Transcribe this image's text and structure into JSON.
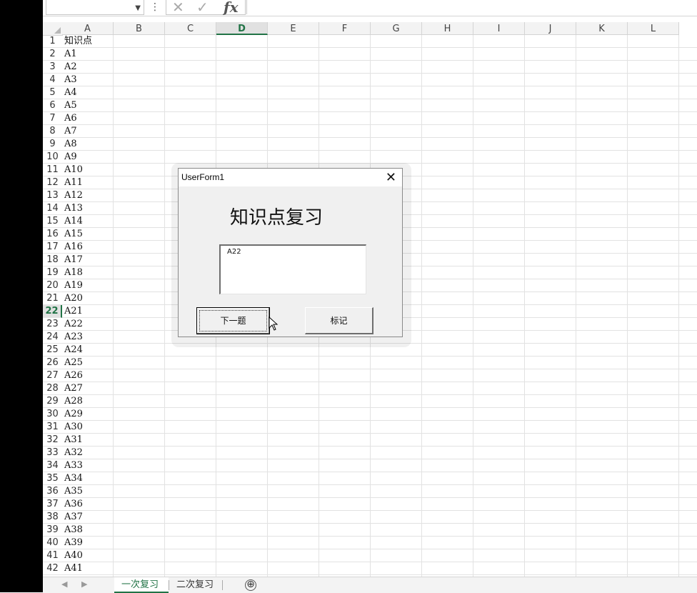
{
  "formula_bar": {
    "fx_label": "fx",
    "cancel_icon": "x-icon",
    "confirm_icon": "check-icon",
    "dots": "⋮"
  },
  "grid": {
    "columns": [
      "A",
      "B",
      "C",
      "D",
      "E",
      "F",
      "G",
      "H",
      "I",
      "J",
      "K",
      "L"
    ],
    "selected_column": "D",
    "selected_row": "22",
    "rows": [
      {
        "n": "1",
        "a": "知识点"
      },
      {
        "n": "2",
        "a": "A1"
      },
      {
        "n": "3",
        "a": "A2"
      },
      {
        "n": "4",
        "a": "A3"
      },
      {
        "n": "5",
        "a": "A4"
      },
      {
        "n": "6",
        "a": "A5"
      },
      {
        "n": "7",
        "a": "A6"
      },
      {
        "n": "8",
        "a": "A7"
      },
      {
        "n": "9",
        "a": "A8"
      },
      {
        "n": "10",
        "a": "A9"
      },
      {
        "n": "11",
        "a": "A10"
      },
      {
        "n": "12",
        "a": "A11"
      },
      {
        "n": "13",
        "a": "A12"
      },
      {
        "n": "14",
        "a": "A13"
      },
      {
        "n": "15",
        "a": "A14"
      },
      {
        "n": "16",
        "a": "A15"
      },
      {
        "n": "17",
        "a": "A16"
      },
      {
        "n": "18",
        "a": "A17"
      },
      {
        "n": "19",
        "a": "A18"
      },
      {
        "n": "20",
        "a": "A19"
      },
      {
        "n": "21",
        "a": "A20"
      },
      {
        "n": "22",
        "a": "A21"
      },
      {
        "n": "23",
        "a": "A22"
      },
      {
        "n": "24",
        "a": "A23"
      },
      {
        "n": "25",
        "a": "A24"
      },
      {
        "n": "26",
        "a": "A25"
      },
      {
        "n": "27",
        "a": "A26"
      },
      {
        "n": "28",
        "a": "A27"
      },
      {
        "n": "29",
        "a": "A28"
      },
      {
        "n": "30",
        "a": "A29"
      },
      {
        "n": "31",
        "a": "A30"
      },
      {
        "n": "32",
        "a": "A31"
      },
      {
        "n": "33",
        "a": "A32"
      },
      {
        "n": "34",
        "a": "A33"
      },
      {
        "n": "35",
        "a": "A34"
      },
      {
        "n": "36",
        "a": "A35"
      },
      {
        "n": "37",
        "a": "A36"
      },
      {
        "n": "38",
        "a": "A37"
      },
      {
        "n": "39",
        "a": "A38"
      },
      {
        "n": "40",
        "a": "A39"
      },
      {
        "n": "41",
        "a": "A40"
      },
      {
        "n": "42",
        "a": "A41"
      }
    ]
  },
  "sheet_tabs": {
    "tabs": [
      "一次复习",
      "二次复习"
    ],
    "active": "一次复习",
    "add_icon": "⊕"
  },
  "dialog": {
    "title": "UserForm1",
    "close_icon": "✕",
    "heading": "知识点复习",
    "textbox_value": "A22",
    "next_button": "下一题",
    "mark_button": "标记"
  },
  "colors": {
    "accent": "#217346",
    "dialog_bg": "#f0f0f0"
  }
}
